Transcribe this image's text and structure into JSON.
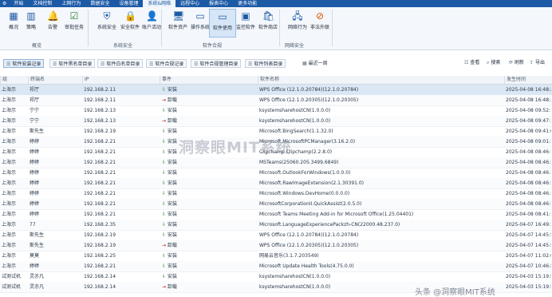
{
  "menubar": {
    "items": [
      "开始",
      "文档控制",
      "上网行为",
      "数据安全",
      "设备管理",
      "系统&网络",
      "远程中心",
      "报表中心",
      "更多功能"
    ],
    "active_index": 5,
    "system_icon": "gear-icon"
  },
  "ribbon": {
    "tools": [
      {
        "label": "概况",
        "icon": "grid-icon"
      },
      {
        "label": "策略",
        "icon": "chart-icon"
      },
      {
        "label": "告警",
        "icon": "bell-icon"
      },
      {
        "label": "审批任务",
        "icon": "checkbox-icon"
      },
      {
        "label": "系统安全",
        "icon": "shield-icon"
      },
      {
        "label": "安全软件",
        "icon": "lock-icon"
      },
      {
        "label": "账户活动",
        "icon": "user-icon"
      },
      {
        "label": "软件资产",
        "icon": "monitor-icon"
      },
      {
        "label": "操作系统",
        "icon": "window-icon"
      },
      {
        "label": "软件使用",
        "icon": "window-icon"
      },
      {
        "label": "监控软件",
        "icon": "app-icon"
      },
      {
        "label": "软件商店",
        "icon": "store-icon"
      },
      {
        "label": "网络行为",
        "icon": "network-icon"
      },
      {
        "label": "非法外联",
        "icon": "block-icon"
      }
    ],
    "groups": [
      "概览",
      "系统安全",
      "软件合规",
      "网络安全"
    ]
  },
  "tabs": [
    {
      "label": "软件安装记录",
      "icon": "list-icon"
    },
    {
      "label": "软件黑名单目录",
      "icon": "list-icon"
    },
    {
      "label": "软件白名单目录",
      "icon": "list-icon"
    },
    {
      "label": "软件合规记录",
      "icon": "list-icon"
    },
    {
      "label": "软件合规管理目录",
      "icon": "list-icon"
    },
    {
      "label": "软件列表目录",
      "icon": "list-icon"
    }
  ],
  "active_tab": 0,
  "date_range": {
    "label": "最近一周",
    "icon": "calendar-icon"
  },
  "right_tools": [
    {
      "label": "查看",
      "icon": "view-icon"
    },
    {
      "label": "搜索",
      "icon": "search-icon"
    },
    {
      "label": "刷新",
      "icon": "refresh-icon"
    },
    {
      "label": "导出",
      "icon": "export-icon"
    }
  ],
  "table": {
    "columns": [
      "组",
      "终端名",
      "IP",
      "事件",
      "软件名称",
      "发生时间"
    ],
    "rows": [
      {
        "group": "上海示",
        "terminal": "祁厅",
        "ip": "192.168.2.11",
        "event": "安装",
        "software": "WPS Office (12.1.0.20784)(12.1.0.20784)",
        "time": "2025-04-08 16:48:34"
      },
      {
        "group": "上海示",
        "terminal": "祁厅",
        "ip": "192.168.2.11",
        "event": "卸载",
        "software": "WPS Office (12.1.0.20305)(12.1.0.20305)",
        "time": "2025-04-08 16:48:34"
      },
      {
        "group": "上海示",
        "terminal": "宁宁",
        "ip": "192.168.2.13",
        "event": "安装",
        "software": "ksystemsharehostCN(1.0.0.0)",
        "time": "2025-04-08 09:52:12"
      },
      {
        "group": "上海示",
        "terminal": "宁宁",
        "ip": "192.168.2.13",
        "event": "卸载",
        "software": "ksystemsharehostCN(1.0.0.0)",
        "time": "2025-04-08 09:47:11"
      },
      {
        "group": "上海示",
        "terminal": "斯先生",
        "ip": "192.168.2.19",
        "event": "安装",
        "software": "Microsoft.BingSearch(1.1.32.0)",
        "time": "2025-04-08 09:41:02"
      },
      {
        "group": "上海示",
        "terminal": "婷婷",
        "ip": "192.168.2.21",
        "event": "安装",
        "software": "Microsoft.MicrosoftPCManager(3.16.2.0)",
        "time": "2025-04-08 09:01:14"
      },
      {
        "group": "上海示",
        "terminal": "婷婷",
        "ip": "192.168.2.21",
        "event": "安装",
        "software": "Clipchamp.Clipchamp(2.2.8.0)",
        "time": "2025-04-08 08:46:12"
      },
      {
        "group": "上海示",
        "terminal": "婷婷",
        "ip": "192.168.2.21",
        "event": "安装",
        "software": "MSTeams(25060.205.3499.6849)",
        "time": "2025-04-08 08:46:12"
      },
      {
        "group": "上海示",
        "terminal": "婷婷",
        "ip": "192.168.2.21",
        "event": "安装",
        "software": "Microsoft.OutlookForWindows(1.0.0.0)",
        "time": "2025-04-08 08:46:12"
      },
      {
        "group": "上海示",
        "terminal": "婷婷",
        "ip": "192.168.2.21",
        "event": "安装",
        "software": "Microsoft.RawImageExtension(2.1.30391.0)",
        "time": "2025-04-08 08:46:12"
      },
      {
        "group": "上海示",
        "terminal": "婷婷",
        "ip": "192.168.2.21",
        "event": "安装",
        "software": "Microsoft.Windows.DevHome(0.0.0.0)",
        "time": "2025-04-08 08:46:12"
      },
      {
        "group": "上海示",
        "terminal": "婷婷",
        "ip": "192.168.2.21",
        "event": "安装",
        "software": "MicrosoftCorporationII.QuickAssist(2.0.5.0)",
        "time": "2025-04-08 08:46:12"
      },
      {
        "group": "上海示",
        "terminal": "婷婷",
        "ip": "192.168.2.21",
        "event": "安装",
        "software": "Microsoft Teams Meeting Add-in for Microsoft Office(1.25.04401)",
        "time": "2025-04-08 08:41:10"
      },
      {
        "group": "上海示",
        "terminal": "77",
        "ip": "192.168.2.35",
        "event": "安装",
        "software": "Microsoft.LanguageExperiencePackzh-CN(22000.48.237.0)",
        "time": "2025-04-07 16:49:19"
      },
      {
        "group": "上海示",
        "terminal": "斯先生",
        "ip": "192.168.2.19",
        "event": "安装",
        "software": "WPS Office (12.1.0.20784)(12.1.0.20784)",
        "time": "2025-04-07 14:45:59"
      },
      {
        "group": "上海示",
        "terminal": "斯先生",
        "ip": "192.168.2.19",
        "event": "卸载",
        "software": "WPS Office (12.1.0.20305)(12.1.0.20305)",
        "time": "2025-04-07 14:45:59"
      },
      {
        "group": "上海示",
        "terminal": "莫莫",
        "ip": "192.168.2.25",
        "event": "安装",
        "software": "网易云音乐(3.1.7.203549)",
        "time": "2025-04-07 11:02:04"
      },
      {
        "group": "上海示",
        "terminal": "婷婷",
        "ip": "192.168.2.21",
        "event": "安装",
        "software": "Microsoft Update Health Tools(4.75.0.0)",
        "time": "2025-04-07 10:46:24"
      },
      {
        "group": "试测试机",
        "terminal": "灵亦凡",
        "ip": "192.168.2.14",
        "event": "安装",
        "software": "ksystemsharehostCN(1.0.0.0)",
        "time": "2025-04-03 15:19:52"
      },
      {
        "group": "试测试机",
        "terminal": "灵亦凡",
        "ip": "192.168.2.14",
        "event": "卸载",
        "software": "ksystemsharehostCN(1.0.0.0)",
        "time": "2025-04-03 15:19:52"
      }
    ]
  },
  "watermark": {
    "center": "洞察眼MIT系统",
    "corner": "头条 @洞察眼MIT系统"
  }
}
